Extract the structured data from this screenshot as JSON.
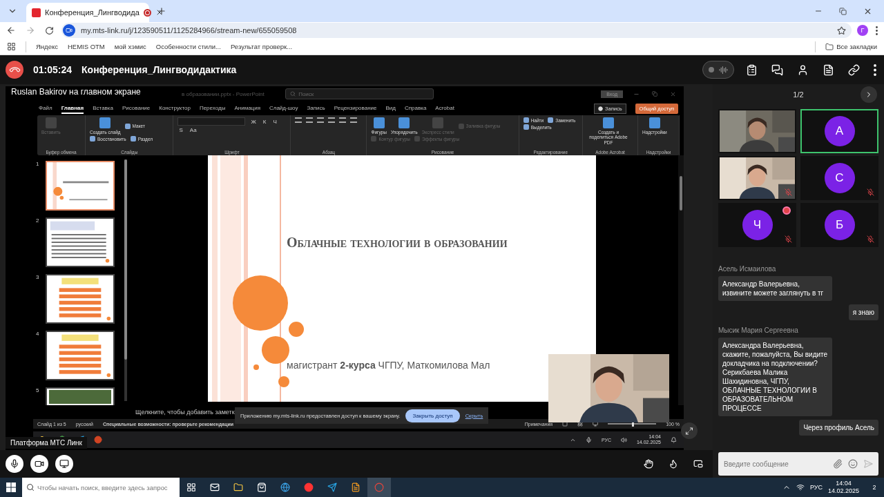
{
  "browser": {
    "tab": {
      "title": "Конференция_Лингводида",
      "recording": true
    },
    "address": "my.mts-link.ru/j/123590511/1125284966/stream-new/655059508",
    "profile_initial": "Г",
    "bookmarks": [
      "Яндекс",
      "HEMIS OTM",
      "мой хэмис",
      "Особенности стили...",
      "Результат проверк..."
    ],
    "all_bookmarks": "Все закладки"
  },
  "meeting": {
    "timer": "01:05:24",
    "title": "Конференция_Лингводидактика",
    "noise_suppression_on": false
  },
  "shared_screen": {
    "presenter_label": "Ruslan Bakirov на главном экране",
    "powerpoint": {
      "file_title": "в образовании.pptx - PowerPoint",
      "search_placeholder": "Поиск",
      "sign_in": "Вход",
      "menu": [
        {
          "label": "Файл",
          "selected": false
        },
        {
          "label": "Главная",
          "selected": true
        },
        {
          "label": "Вставка",
          "selected": false
        },
        {
          "label": "Рисование",
          "selected": false
        },
        {
          "label": "Конструктор",
          "selected": false
        },
        {
          "label": "Переходы",
          "selected": false
        },
        {
          "label": "Анимация",
          "selected": false
        },
        {
          "label": "Слайд-шоу",
          "selected": false
        },
        {
          "label": "Запись",
          "selected": false
        },
        {
          "label": "Рецензирование",
          "selected": false
        },
        {
          "label": "Вид",
          "selected": false
        },
        {
          "label": "Справка",
          "selected": false
        },
        {
          "label": "Acrobat",
          "selected": false
        }
      ],
      "record": "Запись",
      "share": "Общий доступ",
      "ribbon": [
        {
          "label": "Буфер обмена",
          "items": [
            {
              "kind": "large",
              "label": "Вставить",
              "disabled": true
            }
          ]
        },
        {
          "label": "Слайды",
          "items": [
            {
              "kind": "large",
              "label": "Создать слайд",
              "disabled": false
            },
            {
              "kind": "small",
              "label": "Макет",
              "disabled": false
            },
            {
              "kind": "small",
              "label": "Восстановить",
              "disabled": false
            },
            {
              "kind": "small",
              "label": "Раздел",
              "disabled": false
            }
          ]
        },
        {
          "label": "Шрифт",
          "items": [
            {
              "kind": "letter",
              "label": "Ж",
              "disabled": false
            },
            {
              "kind": "letter",
              "label": "К",
              "disabled": false
            },
            {
              "kind": "letter",
              "label": "Ч",
              "disabled": false
            },
            {
              "kind": "letter",
              "label": "S",
              "disabled": false
            },
            {
              "kind": "letter",
              "label": "Aa",
              "disabled": false
            }
          ]
        },
        {
          "label": "Абзац"
        },
        {
          "label": "Рисование",
          "items": [
            {
              "kind": "large",
              "label": "Фигуры",
              "disabled": false
            },
            {
              "kind": "large",
              "label": "Упорядочить",
              "disabled": false
            },
            {
              "kind": "large",
              "label": "Экспресс стили",
              "disabled": true
            },
            {
              "kind": "small",
              "label": "Заливка фигуры",
              "disabled": true
            },
            {
              "kind": "small",
              "label": "Контур фигуры",
              "disabled": true
            },
            {
              "kind": "small",
              "label": "Эффекты фигуры",
              "disabled": true
            }
          ]
        },
        {
          "label": "Редактирование",
          "items": [
            {
              "kind": "small",
              "label": "Найти",
              "disabled": false
            },
            {
              "kind": "small",
              "label": "Заменить",
              "disabled": false
            },
            {
              "kind": "small",
              "label": "Выделить",
              "disabled": false
            }
          ]
        },
        {
          "label": "Adobe Acrobat",
          "items": [
            {
              "kind": "large",
              "label": "Создать и поделиться Adobe PDF",
              "disabled": false
            }
          ]
        },
        {
          "label": "Надстройки",
          "items": [
            {
              "kind": "large",
              "label": "Надстройки",
              "disabled": false
            }
          ]
        }
      ],
      "slides": [
        {
          "number": "1",
          "selected": true
        },
        {
          "number": "2",
          "selected": false
        },
        {
          "number": "3",
          "selected": false
        },
        {
          "number": "4",
          "selected": false
        },
        {
          "number": "5",
          "selected": false
        }
      ],
      "slide": {
        "title": "Облачные технологии в образовании",
        "subtitle": "магистрант **2-курса** ЧГПУ, Маткомилова Мал"
      },
      "notes_placeholder": "Щелкните, чтобы добавить заметк",
      "status": {
        "slide": "Слайд 1 из 5",
        "language": "русский",
        "accessibility": "Специальные возможности: проверьте рекомендации",
        "comments": "Примечания",
        "zoom": "100 %",
        "zoom_level": {
          "level": 0.5
        }
      }
    },
    "share_banner": {
      "message": "Приложению my.mts-link.ru предоставлен доступ к вашему экрану.",
      "stop": "Закрыть доступ",
      "hide": "Скрыть"
    },
    "inner_taskbar": {
      "language": "РУС",
      "time": "14:04",
      "date": "14.02.2025"
    },
    "tooltip": "Платформа МТС Линк"
  },
  "participants": {
    "page": "1/2",
    "tiles": [
      {
        "kind": "video",
        "speaking": false,
        "muted": false,
        "alert": false
      },
      {
        "kind": "avatar",
        "initial": "А",
        "speaking": true,
        "muted": false,
        "alert": false
      },
      {
        "kind": "video",
        "speaking": false,
        "muted": true,
        "alert": false
      },
      {
        "kind": "avatar",
        "initial": "С",
        "speaking": false,
        "muted": true,
        "alert": false
      },
      {
        "kind": "avatar",
        "initial": "Ч",
        "speaking": false,
        "muted": true,
        "alert": true
      },
      {
        "kind": "avatar",
        "initial": "Б",
        "speaking": false,
        "muted": true,
        "alert": false
      }
    ]
  },
  "chat": {
    "messages": [
      {
        "kind": "incoming",
        "author": "Асель Исмаилова",
        "text": "Александр Валерьевна, извините можете заглянуть в тг"
      },
      {
        "kind": "outgoing",
        "text": "я знаю"
      },
      {
        "kind": "incoming",
        "author": "Мысик Мария Сергеевна",
        "text": "Александра Валерьевна, скажите, пожалуйста, Вы видите докладчика на подключении? Серикбаева Малика Шахидиновна, ЧГПУ, ОБЛАЧНЫЕ ТЕХНОЛОГИИ В ОБРАЗОВАТЕЛЬНОМ ПРОЦЕССЕ"
      },
      {
        "kind": "outgoing",
        "text": "Через профиль Асель"
      }
    ],
    "input_placeholder": "Введите сообщение"
  },
  "taskbar": {
    "search_placeholder": "Чтобы начать поиск, введите здесь запрос",
    "language": "РУС",
    "time": "14:04",
    "date": "14.02.2025",
    "notifications": "2"
  }
}
